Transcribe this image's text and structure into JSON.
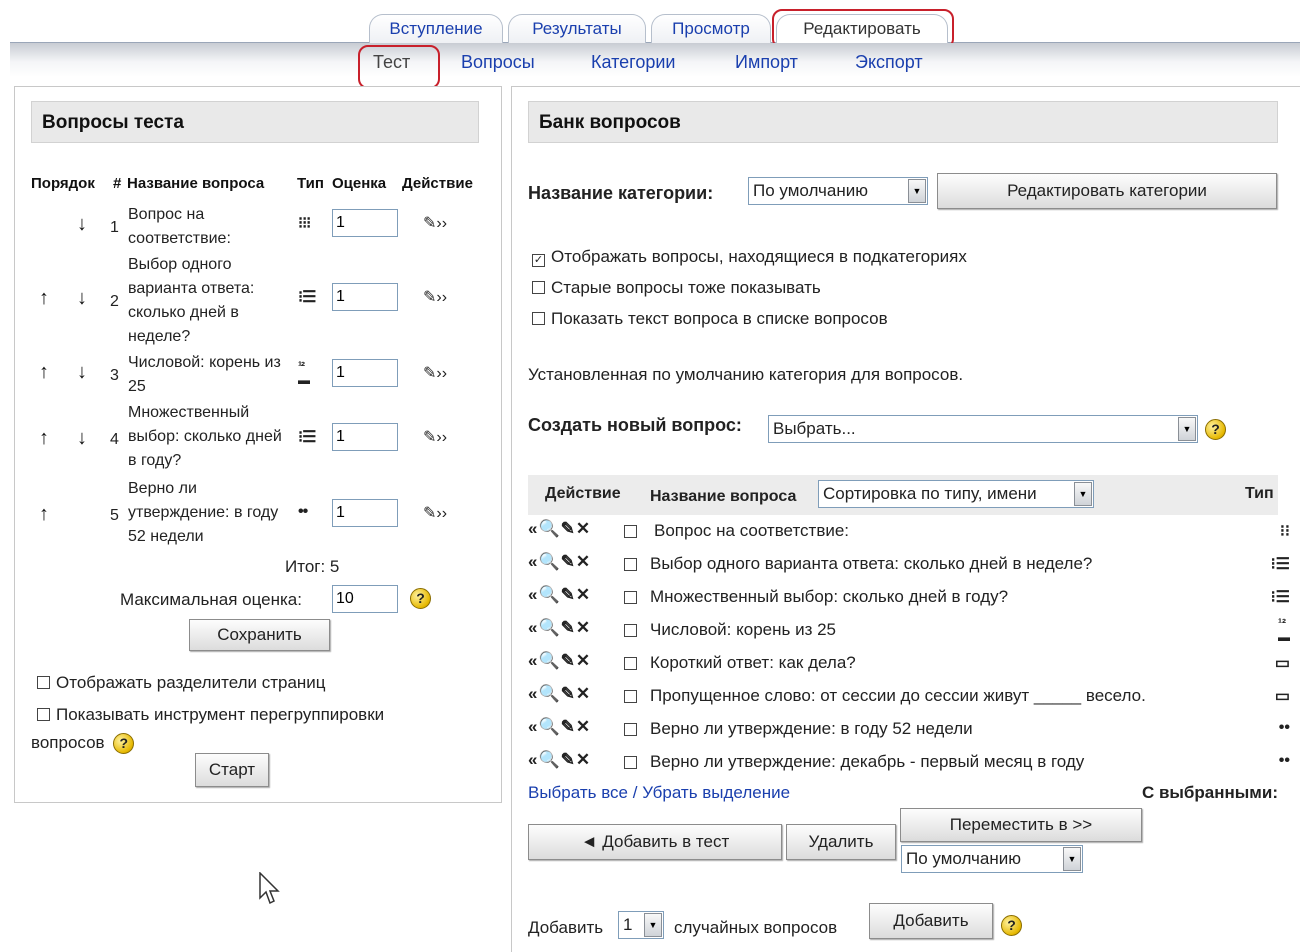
{
  "tabs": {
    "primary": [
      "Вступление",
      "Результаты",
      "Просмотр",
      "Редактировать"
    ],
    "secondary": [
      "Тест",
      "Вопросы",
      "Категории",
      "Импорт",
      "Экспорт"
    ]
  },
  "quiz": {
    "title": "Вопросы теста",
    "columns": [
      "Порядок",
      "#",
      "Название вопроса",
      "Тип",
      "Оценка",
      "Действие"
    ],
    "questions": [
      {
        "num": "1",
        "name": "Вопрос на соответствие:",
        "grade": "1"
      },
      {
        "num": "2",
        "name": "Выбор одного варианта ответа: сколько дней в неделе?",
        "grade": "1"
      },
      {
        "num": "3",
        "name": "Числовой: корень из 25",
        "grade": "1"
      },
      {
        "num": "4",
        "name": "Множественный выбор: сколько дней в году?",
        "grade": "1"
      },
      {
        "num": "5",
        "name": "Верно ли утверждение: в году 52 недели",
        "grade": "1"
      }
    ],
    "total_label": "Итог: 5",
    "max_grade_label": "Максимальная оценка:",
    "max_grade_value": "10",
    "save_label": "Сохранить",
    "show_breaks_label": "Отображать разделители страниц",
    "show_regroup_label": "Показывать инструмент перегруппировки",
    "show_regroup_label2": "вопросов",
    "start_label": "Старт"
  },
  "bank": {
    "title": "Банк вопросов",
    "category_label": "Название категории:",
    "category_value": "По умолчанию",
    "edit_categories_label": "Редактировать категории",
    "opt_subcats": "Отображать вопросы, находящиеся в подкатегориях",
    "opt_old": "Старые вопросы тоже показывать",
    "opt_text": "Показать текст вопроса в списке вопросов",
    "default_note": "Установленная по умолчанию категория для вопросов.",
    "create_label": "Создать новый вопрос:",
    "create_value": "Выбрать...",
    "col_action": "Действие",
    "col_name": "Название вопроса",
    "sort_value": "Сортировка по типу, имени",
    "col_type": "Тип",
    "items": [
      "Вопрос на соответствие:",
      "Выбор одного варианта ответа: сколько дней в неделе?",
      "Множественный выбор: сколько дней в году?",
      "Числовой: корень из 25",
      "Короткий ответ: как дела?",
      "Пропущенное слово: от сессии до сессии живут _____ весело.",
      "Верно ли утверждение: в году 52 недели",
      "Верно ли утверждение: декабрь - первый месяц в году"
    ],
    "select_all": "Выбрать все",
    "separator": "/",
    "deselect": "Убрать выделение",
    "with_selected": "С выбранными:",
    "add_to_quiz": "◄ Добавить в тест",
    "delete_label": "Удалить",
    "move_label": "Переместить в >>",
    "move_target": "По умолчанию",
    "random_prefix": "Добавить",
    "random_count": "1",
    "random_suffix": "случайных вопросов",
    "add_label": "Добавить"
  },
  "icons": {
    "type_matching": "matching-type-icon",
    "type_multichoice": "multichoice-type-icon",
    "type_numerical": "numerical-type-icon",
    "type_shortanswer": "shortanswer-type-icon",
    "type_truefalse": "truefalse-type-icon",
    "accent": "#c8202b"
  }
}
